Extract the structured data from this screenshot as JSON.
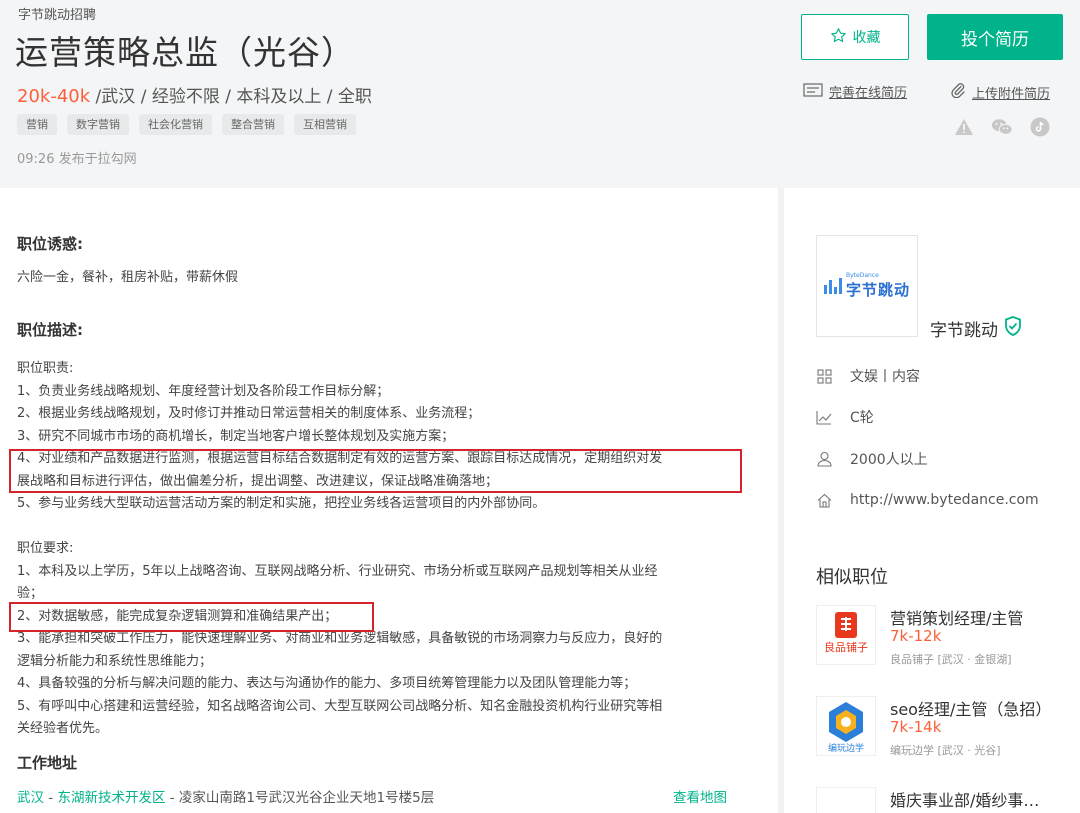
{
  "header": {
    "company": "字节跳动招聘",
    "title": "运营策略总监（光谷）",
    "salary": "20k-40k",
    "requirements": " /武汉 / 经验不限 / 本科及以上 / 全职",
    "tags": [
      "营销",
      "数字营销",
      "社会化营销",
      "整合营销",
      "互相营销"
    ],
    "publish_time": "09:26  发布于拉勾网",
    "favorite_label": "收藏",
    "apply_label": "投个简历",
    "online_resume_label": "完善在线简历",
    "upload_resume_label": "上传附件简历"
  },
  "main": {
    "perks_title": "职位诱惑:",
    "perks": "六险一金，餐补，租房补贴，带薪休假",
    "desc_title": "职位描述:",
    "duties_title": "职位职责:",
    "duties": [
      "1、负责业务线战略规划、年度经营计划及各阶段工作目标分解；",
      "2、根据业务线战略规划，及时修订并推动日常运营相关的制度体系、业务流程；",
      "3、研究不同城市市场的商机增长，制定当地客户增长整体规划及实施方案；",
      "4、对业绩和产品数据进行监测，根据运营目标结合数据制定有效的运营方案、跟踪目标达成情况，定期组织对发",
      "展战略和目标进行评估，做出偏差分析，提出调整、改进建议，保证战略准确落地；",
      "5、参与业务线大型联动运营活动方案的制定和实施，把控业务线各运营项目的内外部协同。"
    ],
    "req_title": "职位要求:",
    "reqs": [
      "1、本科及以上学历，5年以上战略咨询、互联网战略分析、行业研究、市场分析或互联网产品规划等相关从业经",
      "验；",
      "2、对数据敏感，能完成复杂逻辑测算和准确结果产出；",
      "3、能承担和突破工作压力，能快速理解业务、对商业和业务逻辑敏感，具备敏锐的市场洞察力与反应力，良好的",
      "逻辑分析能力和系统性思维能力；",
      "4、具备较强的分析与解决问题的能力、表达与沟通协作的能力、多项目统筹管理能力以及团队管理能力等；",
      "5、有呼叫中心搭建和运营经验，知名战略咨询公司、大型互联网公司战略分析、知名金融投资机构行业研究等相",
      "关经验者优先。"
    ],
    "addr_title": "工作地址",
    "addr_city": "武汉",
    "addr_sep1": " - ",
    "addr_district": "东湖新技术开发区",
    "addr_detail": " - 凌家山南路1号武汉光谷企业天地1号楼5层",
    "map_link": "查看地图"
  },
  "sidebar": {
    "logo_en": "ByteDance",
    "logo_cn": "字节跳动",
    "company_name": "字节跳动",
    "industry": "文娱丨内容",
    "stage": "C轮",
    "size": "2000人以上",
    "website": "http://www.bytedance.com",
    "similar_title": "相似职位",
    "similar": [
      {
        "title": "营销策划经理/主管",
        "salary": "7k-12k",
        "company": "良品铺子 [武汉 · 金银湖]",
        "logo_text": "良品铺子"
      },
      {
        "title": "seo经理/主管（急招）",
        "salary": "7k-14k",
        "company": "编玩边学 [武汉 · 光谷]",
        "logo_text": "编玩边学"
      },
      {
        "title": "婚庆事业部/婚纱事…",
        "salary": "",
        "company": "",
        "logo_text": ""
      }
    ]
  },
  "colors": {
    "accent": "#00b38a",
    "salary": "#fd5f39",
    "highlight": "#d6242c"
  }
}
